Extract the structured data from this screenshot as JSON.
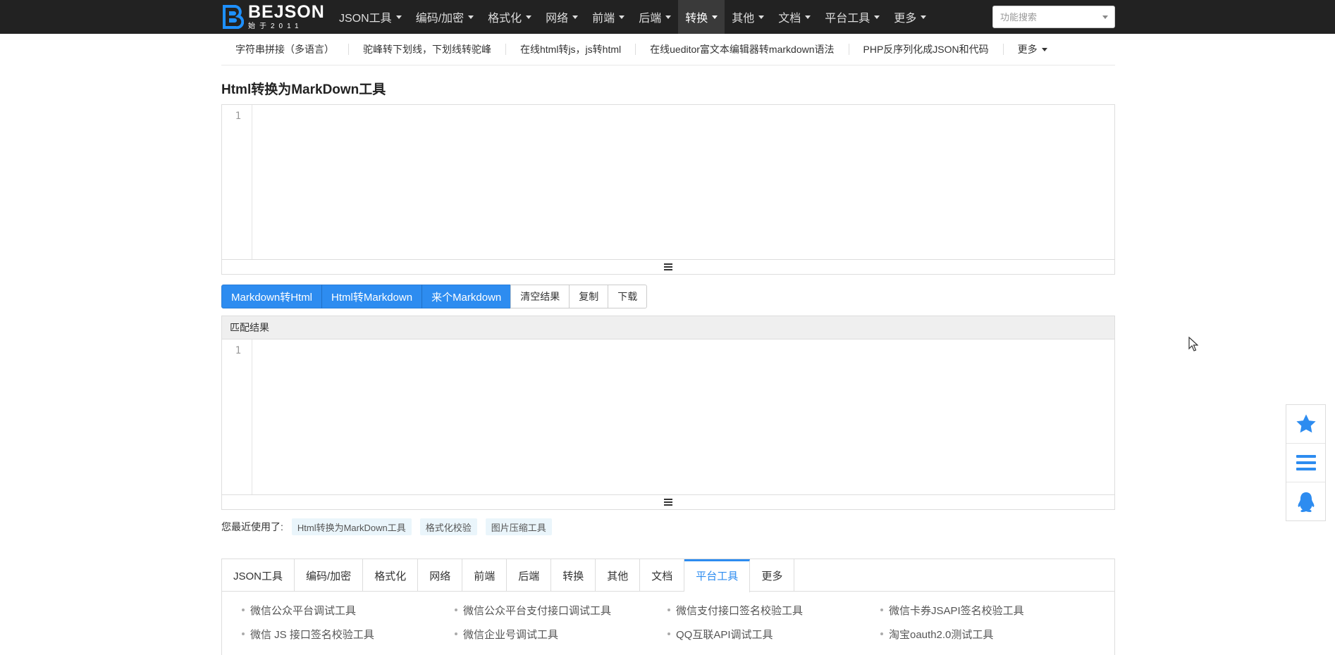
{
  "logo": {
    "name": "BEJSON",
    "tagline": "始于2011"
  },
  "nav": {
    "items": [
      {
        "label": "JSON工具",
        "active": false
      },
      {
        "label": "编码/加密",
        "active": false
      },
      {
        "label": "格式化",
        "active": false
      },
      {
        "label": "网络",
        "active": false
      },
      {
        "label": "前端",
        "active": false
      },
      {
        "label": "后端",
        "active": false
      },
      {
        "label": "转换",
        "active": true
      },
      {
        "label": "其他",
        "active": false
      },
      {
        "label": "文档",
        "active": false
      },
      {
        "label": "平台工具",
        "active": false
      },
      {
        "label": "更多",
        "active": false
      }
    ],
    "search_placeholder": "功能搜索"
  },
  "subnav": {
    "links": [
      "字符串拼接（多语言）",
      "驼峰转下划线，下划线转驼峰",
      "在线html转js，js转html",
      "在线ueditor富文本编辑器转markdown语法",
      "PHP反序列化成JSON和代码"
    ],
    "more": "更多"
  },
  "page_title": "Html转换为MarkDown工具",
  "input_editor": {
    "line_number": "1"
  },
  "buttons": {
    "md_to_html": "Markdown转Html",
    "html_to_md": "Html转Markdown",
    "sample_md": "来个Markdown",
    "clear": "清空结果",
    "copy": "复制",
    "download": "下载"
  },
  "result": {
    "title": "匹配结果",
    "line_number": "1"
  },
  "recent": {
    "label": "您最近使用了:",
    "tags": [
      "Html转换为MarkDown工具",
      "格式化校验",
      "图片压缩工具"
    ]
  },
  "category_tabs": {
    "tabs": [
      {
        "label": "JSON工具",
        "active": false
      },
      {
        "label": "编码/加密",
        "active": false
      },
      {
        "label": "格式化",
        "active": false
      },
      {
        "label": "网络",
        "active": false
      },
      {
        "label": "前端",
        "active": false
      },
      {
        "label": "后端",
        "active": false
      },
      {
        "label": "转换",
        "active": false
      },
      {
        "label": "其他",
        "active": false
      },
      {
        "label": "文档",
        "active": false
      },
      {
        "label": "平台工具",
        "active": true
      },
      {
        "label": "更多",
        "active": false
      }
    ],
    "links": [
      "微信公众平台调试工具",
      "微信公众平台支付接口调试工具",
      "微信支付接口签名校验工具",
      "微信卡券JSAPI签名校验工具",
      "微信 JS 接口签名校验工具",
      "微信企业号调试工具",
      "QQ互联API调试工具",
      "淘宝oauth2.0测试工具"
    ]
  },
  "side_actions": {
    "icons": [
      "star-icon",
      "menu-icon",
      "qq-penguin-icon"
    ],
    "accent": "#2d8cf0"
  },
  "colors": {
    "accent": "#2d8cf0",
    "nav_bg": "#222222",
    "logo_blue": "#1e90ff"
  }
}
